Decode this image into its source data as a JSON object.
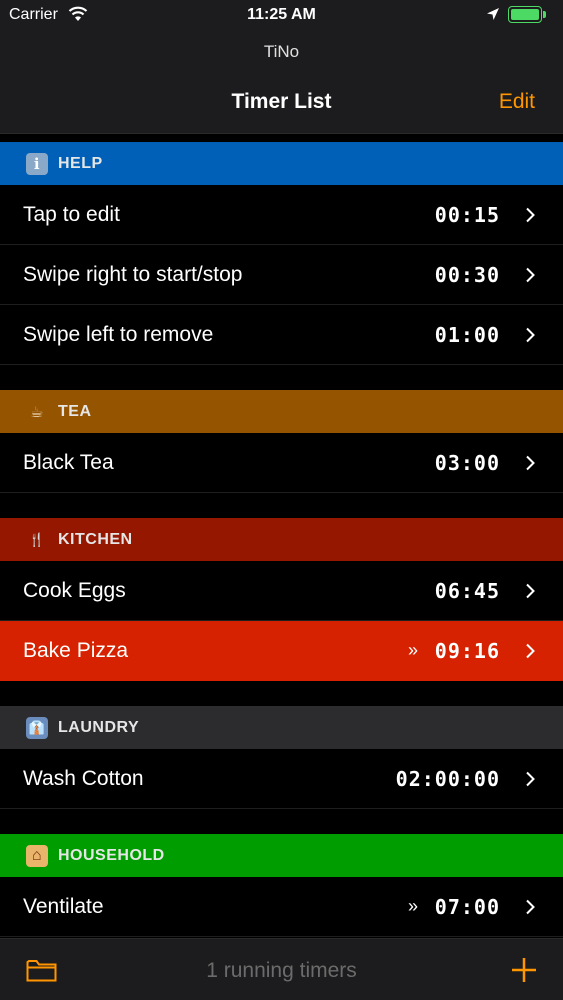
{
  "status_bar": {
    "carrier": "Carrier",
    "time": "11:25 AM",
    "battery_level": 1.0,
    "icons": [
      "wifi-icon",
      "location-arrow-icon",
      "battery-icon"
    ]
  },
  "nav": {
    "app_name": "TiNo",
    "title": "Timer List",
    "edit_label": "Edit"
  },
  "colors": {
    "accent": "#ff9500",
    "help": "#0060b8",
    "tea": "#955400",
    "kitchen": "#951700",
    "laundry": "#2c2c2e",
    "household": "#009d00",
    "running_row": "#d62200"
  },
  "sections": [
    {
      "name": "HELP",
      "icon": "info-icon",
      "color": "#0060b8",
      "rows": [
        {
          "label": "Tap to edit",
          "value": "00:15",
          "running": false
        },
        {
          "label": "Swipe right to start/stop",
          "value": "00:30",
          "running": false
        },
        {
          "label": "Swipe left to remove",
          "value": "01:00",
          "running": false
        }
      ]
    },
    {
      "name": "TEA",
      "icon": "tea-cup-icon",
      "color": "#955400",
      "rows": [
        {
          "label": "Black Tea",
          "value": "03:00",
          "running": false
        }
      ]
    },
    {
      "name": "KITCHEN",
      "icon": "fork-knife-icon",
      "color": "#951700",
      "rows": [
        {
          "label": "Cook Eggs",
          "value": "06:45",
          "running": false
        },
        {
          "label": "Bake Pizza",
          "value": "09:16",
          "running": true,
          "run_mark": "»"
        }
      ]
    },
    {
      "name": "LAUNDRY",
      "icon": "shirt-icon",
      "color": "#2c2c2e",
      "rows": [
        {
          "label": "Wash Cotton",
          "value": "02:00:00",
          "running": false
        }
      ]
    },
    {
      "name": "HOUSEHOLD",
      "icon": "house-icon",
      "color": "#009d00",
      "rows": [
        {
          "label": "Ventilate",
          "value": "07:00",
          "running": false,
          "run_mark": "»"
        }
      ]
    }
  ],
  "toolbar": {
    "status_text": "1 running timers",
    "left_icon": "folder-icon",
    "right_icon": "plus-icon"
  }
}
